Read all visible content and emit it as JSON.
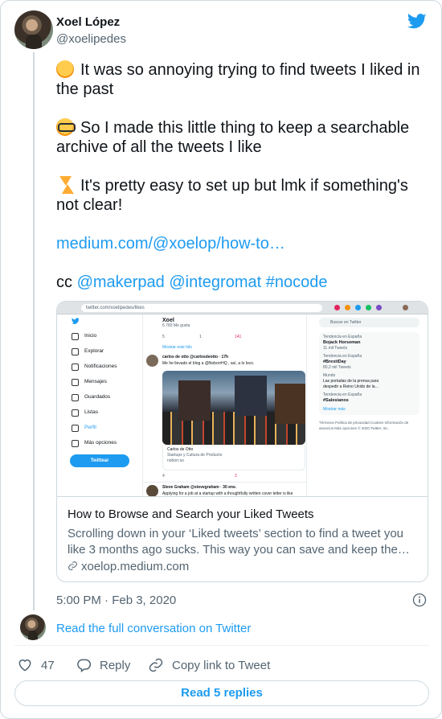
{
  "author": {
    "name": "Xoel López",
    "handle": "@xoelipedes"
  },
  "tweet": {
    "line1": "It was so annoying trying to find tweets I liked in the past",
    "line2": "So I made this little thing to keep a searchable archive of all the tweets I like",
    "line3": "It's pretty easy to set up but lmk if something's not clear!",
    "url_text": "medium.com/@xoelop/how-to…",
    "cc_prefix": "cc",
    "mention1": "@makerpad",
    "mention2": "@integromat",
    "hashtag": "#nocode"
  },
  "link_card": {
    "title": "How to Browse and Search your Liked Tweets",
    "description": "Scrolling down in your ‘Liked tweets’ section to find a tweet you like 3 months ago sucks. This way you can save and keep the…",
    "domain": "xoelop.medium.com"
  },
  "screenshot": {
    "url": "twitter.com/xoelipedes/likes",
    "nav": [
      "Inicio",
      "Explorar",
      "Notificaciones",
      "Mensajes",
      "Guardados",
      "Listas",
      "Perfil",
      "Más opciones"
    ],
    "tweet_button": "Twittear",
    "profile_name": "Xoel",
    "profile_sub": "6.783 Me gusta",
    "counts": [
      "5",
      "1",
      "141"
    ],
    "show_thread": "Mostrar este hilo",
    "tweet_author": "carlos de otto @carlosdeotto · 17h",
    "tweet_text": "Me he llevado el blog a @NoborrHQ , así, a lo loco.",
    "card_title": "Carlos de Otto",
    "card_sub": "Startups y Cultura de Producto",
    "card_domain": "noborr.so",
    "counts2": [
      "4",
      "2"
    ],
    "next_author": "Steve Graham @stevegraham · 30 ene.",
    "next_text": "Applying for a job at a startup with a thoughtfully written cover letter is like",
    "search_placeholder": "Buscar en Twitter",
    "trends": [
      {
        "meta": "Tendencia en España",
        "name": "Bojack Horseman",
        "count": "11 mil Tweets"
      },
      {
        "meta": "Tendencia en España",
        "name": "#BrexitDay",
        "count": "80,2 mil Tweets"
      },
      {
        "meta": "Mundo",
        "name": "Las portadas de la prensa para despedir a Reino Unido de la…",
        "count": ""
      },
      {
        "meta": "Tendencia en España",
        "name": "#Salesianos",
        "count": ""
      }
    ],
    "show_more": "Mostrar más",
    "footer": "Términos  Política de privacidad  Cookies  Información de anuncios  Más opciones  © 2020 Twitter, Inc."
  },
  "meta": {
    "timestamp": "5:00 PM · Feb 3, 2020",
    "conversation_link": "Read the full conversation on Twitter",
    "likes": "47",
    "reply_label": "Reply",
    "copy_label": "Copy link to Tweet",
    "replies_button": "Read 5 replies"
  },
  "colors": {
    "accent": "#1d9bf0",
    "text": "#0f1419",
    "secondary": "#536471",
    "like": "#f91880"
  },
  "icons": [
    "twitter-bird-icon",
    "sleepy-face-emoji",
    "nerd-face-emoji",
    "lightning-emoji",
    "link-icon",
    "info-icon",
    "heart-icon",
    "reply-icon",
    "copy-link-icon"
  ]
}
